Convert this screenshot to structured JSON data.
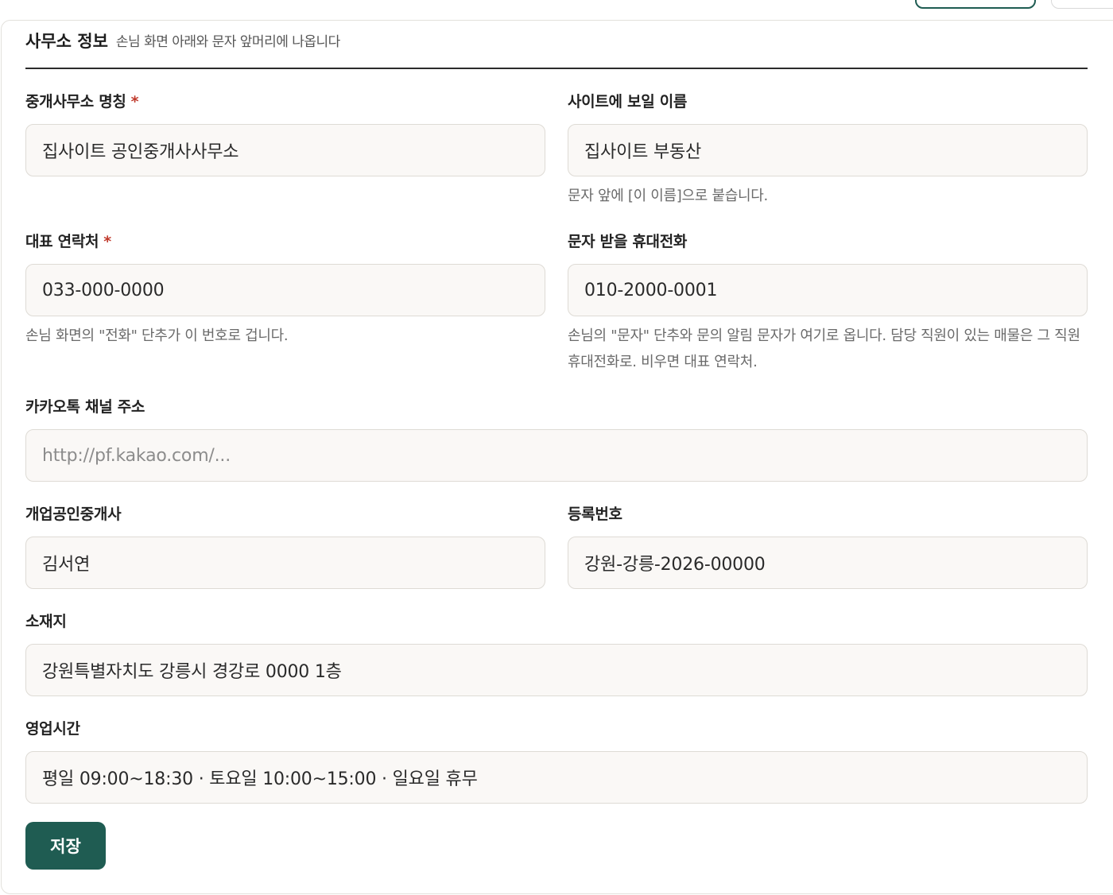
{
  "section": {
    "title": "사무소 정보",
    "subtitle": "손님 화면 아래와 문자 앞머리에 나옵니다"
  },
  "fields": {
    "office_name": {
      "label": "중개사무소 명칭",
      "required_mark": "*",
      "value": "집사이트 공인중개사사무소"
    },
    "site_name": {
      "label": "사이트에 보일 이름",
      "value": "집사이트 부동산",
      "help": "문자 앞에 [이 이름]으로 붙습니다."
    },
    "main_phone": {
      "label": "대표 연락처",
      "required_mark": "*",
      "value": "033-000-0000",
      "help": "손님 화면의 \"전화\" 단추가 이 번호로 겁니다."
    },
    "sms_phone": {
      "label": "문자 받을 휴대전화",
      "value": "010-2000-0001",
      "help_line1": "손님의 \"문자\" 단추와 문의 알림 문자가 여기로 옵니다. 담당 직원이 있는 매물은 그 직원",
      "help_line2": "휴대전화로. 비우면 대표 연락처."
    },
    "kakao": {
      "label": "카카오톡 채널 주소",
      "placeholder": "http://pf.kakao.com/..."
    },
    "broker": {
      "label": "개업공인중개사",
      "value": "김서연"
    },
    "reg_no": {
      "label": "등록번호",
      "value": "강원-강릉-2026-00000"
    },
    "address": {
      "label": "소재지",
      "value": "강원특별자치도 강릉시 경강로 0000 1층"
    },
    "hours": {
      "label": "영업시간",
      "value": "평일 09:00~18:30 · 토요일 10:00~15:00 · 일요일 휴무"
    }
  },
  "actions": {
    "save_label": "저장"
  }
}
